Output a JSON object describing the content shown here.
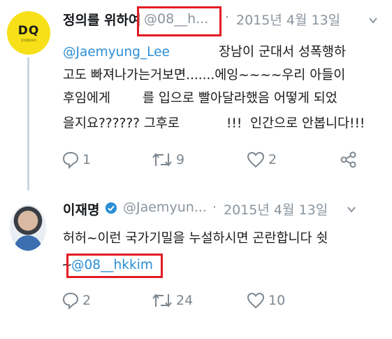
{
  "tweet1": {
    "name": "정의를 위하여",
    "handle": "@08__h...",
    "dot": "·",
    "date": "2015년 4월 13일",
    "mention": "@Jaemyung_Lee",
    "line1_rest": "장남이 군대서 성폭행하",
    "line2": "고도 빠져나가는거보면.......에잉~~~~우리 아들이",
    "line3a": "후임에게",
    "line3b": "를 입으로 빨아달라했음 어떻게 되었",
    "line4a": "을지요?????? 그후로",
    "line4b": "!!!  인간으로 안봅니다!!!",
    "reply_count": "1",
    "retweet_count": "9",
    "like_count": "2"
  },
  "tweet2": {
    "name": "이재명",
    "handle": "@Jaemyun...",
    "dot": "·",
    "date": "2015년 4월 13일",
    "line1": "허허~이런 국가기밀을 누설하시면 곤란합니다 쉿",
    "tilde": "~",
    "mention": "@08__hkkim",
    "reply_count": "2",
    "retweet_count": "24",
    "like_count": "10"
  },
  "avatar1": {
    "glyph": "DQ",
    "caption": "정의를위하여"
  },
  "colors": {
    "accent": "#2b8fd6",
    "highlight": "#e31b23",
    "muted": "#8a949e"
  }
}
